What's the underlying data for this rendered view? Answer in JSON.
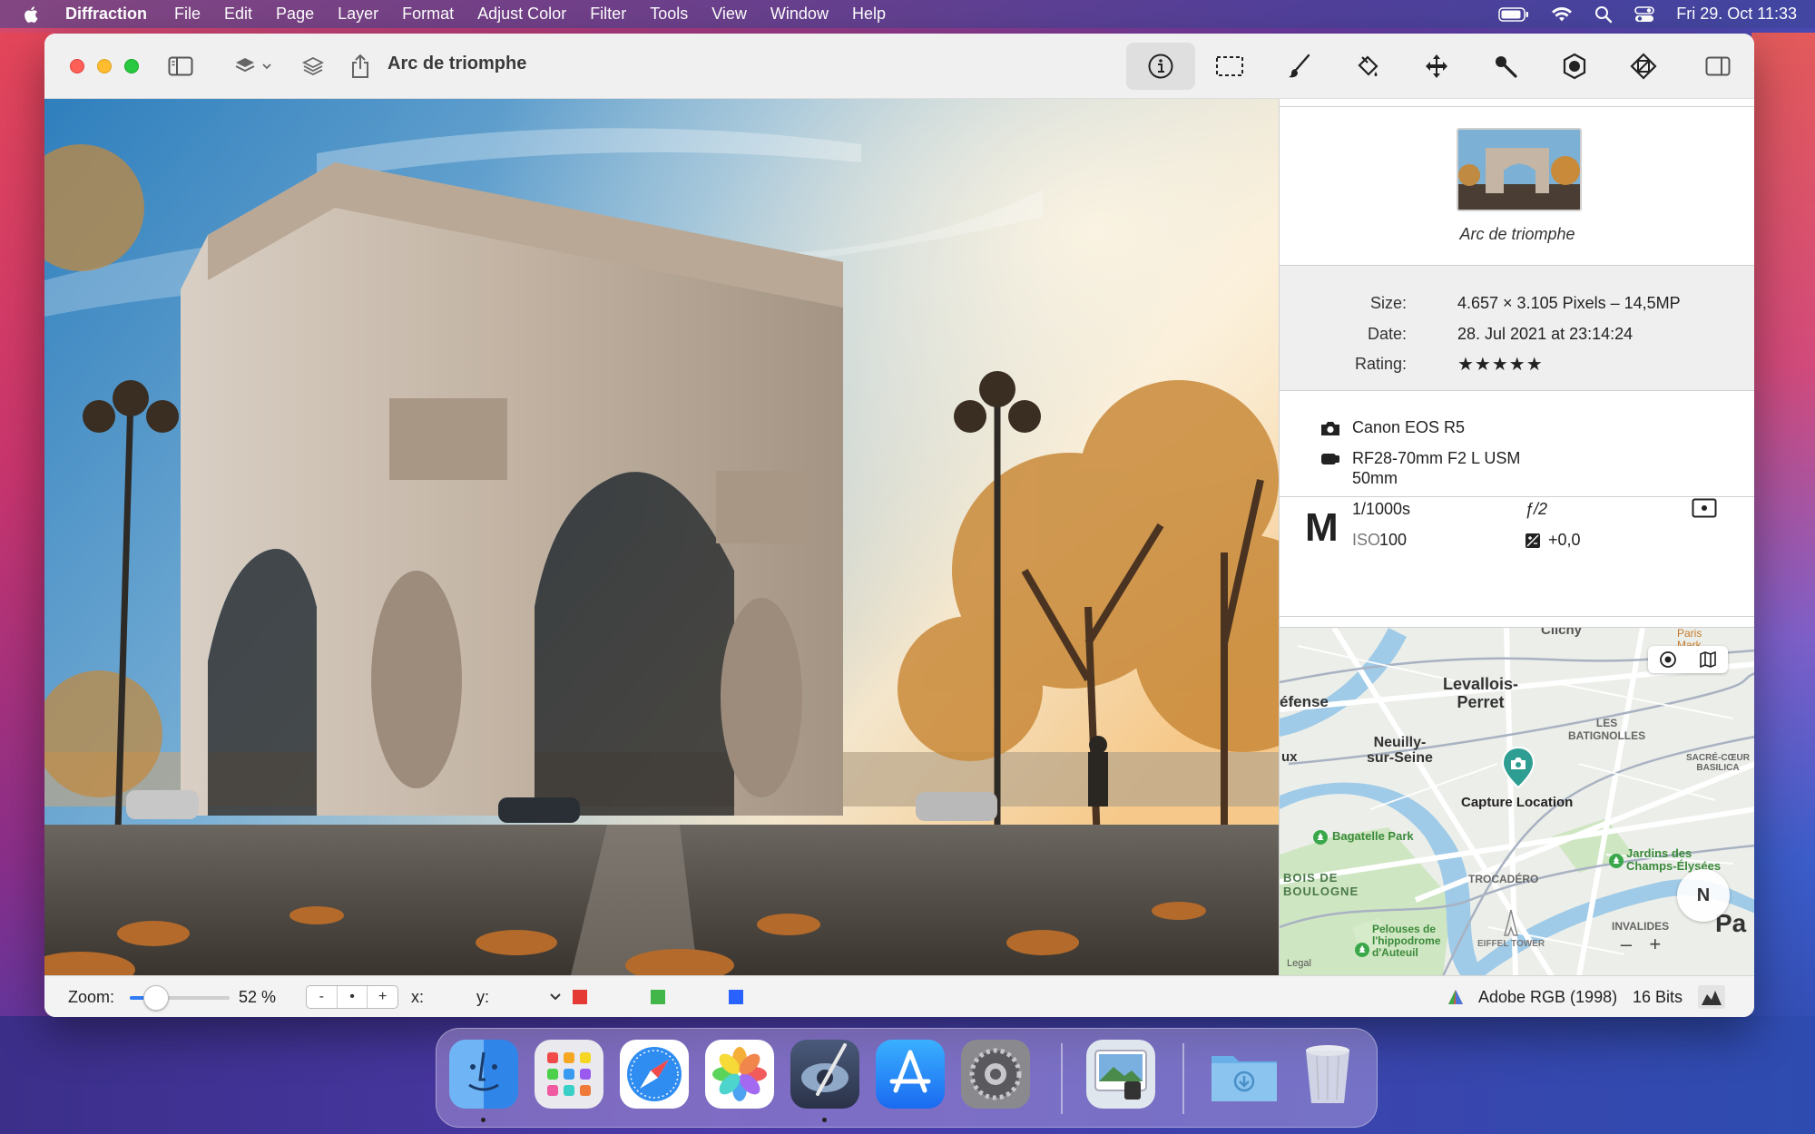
{
  "menubar": {
    "app_name": "Diffraction",
    "items": [
      "File",
      "Edit",
      "Page",
      "Layer",
      "Format",
      "Adjust Color",
      "Filter",
      "Tools",
      "View",
      "Window",
      "Help"
    ],
    "clock": "Fri 29. Oct  11:33"
  },
  "window": {
    "title": "Arc de triomphe"
  },
  "inspector": {
    "thumbnail_caption": "Arc de triomphe",
    "size_label": "Size:",
    "size_value": "4.657 × 3.105 Pixels – 14,5MP",
    "date_label": "Date:",
    "date_value": "28. Jul 2021 at 23:14:24",
    "rating_label": "Rating:",
    "rating_stars": "★★★★★",
    "camera": "Canon EOS R5",
    "lens": "RF28-70mm F2 L USM",
    "focal_length": "50mm",
    "mode": "M",
    "shutter": "1/1000s",
    "aperture": "ƒ/2",
    "iso_label": "ISO",
    "iso_value": "100",
    "exposure_comp": "+0,0"
  },
  "map": {
    "labels": {
      "clichy": "Clichy",
      "levallois": "Levallois-\nPerret",
      "defense": "éfense",
      "neuilly": "Neuilly-\nsur-Seine",
      "batignolles": "LES\nBATIGNOLLES",
      "sacre_coeur": "SACRÉ-CŒUR\nBASILICA",
      "ux": "ux",
      "capture": "Capture Location",
      "bagatelle": "Bagatelle Park",
      "bois": "BOIS DE\nBOULOGNE",
      "trocadero": "TROCADÉRO",
      "champs": "Jardins des\nChamps-Élysées",
      "invalides": "INVALIDES",
      "pelouses": "Pelouses de\nl'hippodrome\nd'Auteuil",
      "eiffel": "EIFFEL TOWER",
      "paris_mark": "Paris\nMark",
      "pa": "Pa",
      "legal": "Legal",
      "compass": "N"
    }
  },
  "statusbar": {
    "zoom_label": "Zoom:",
    "zoom_value": "52 %",
    "zoom_fraction": 0.52,
    "stepper": [
      "-",
      "•",
      "+"
    ],
    "x_label": "x:",
    "y_label": "y:",
    "color_profile": "Adobe RGB (1998)",
    "bit_depth": "16 Bits"
  },
  "colors": {
    "accent": "#2f7cf6",
    "swatch_red": "#e53935",
    "swatch_green": "#43b649",
    "swatch_blue": "#2962ff",
    "map_pin": "#2e9e92"
  },
  "dock": {
    "apps": [
      "Finder",
      "Launchpad",
      "Safari",
      "Photos",
      "Diffraction",
      "App Store",
      "System Preferences",
      "Preview",
      "Downloads",
      "Trash"
    ]
  }
}
